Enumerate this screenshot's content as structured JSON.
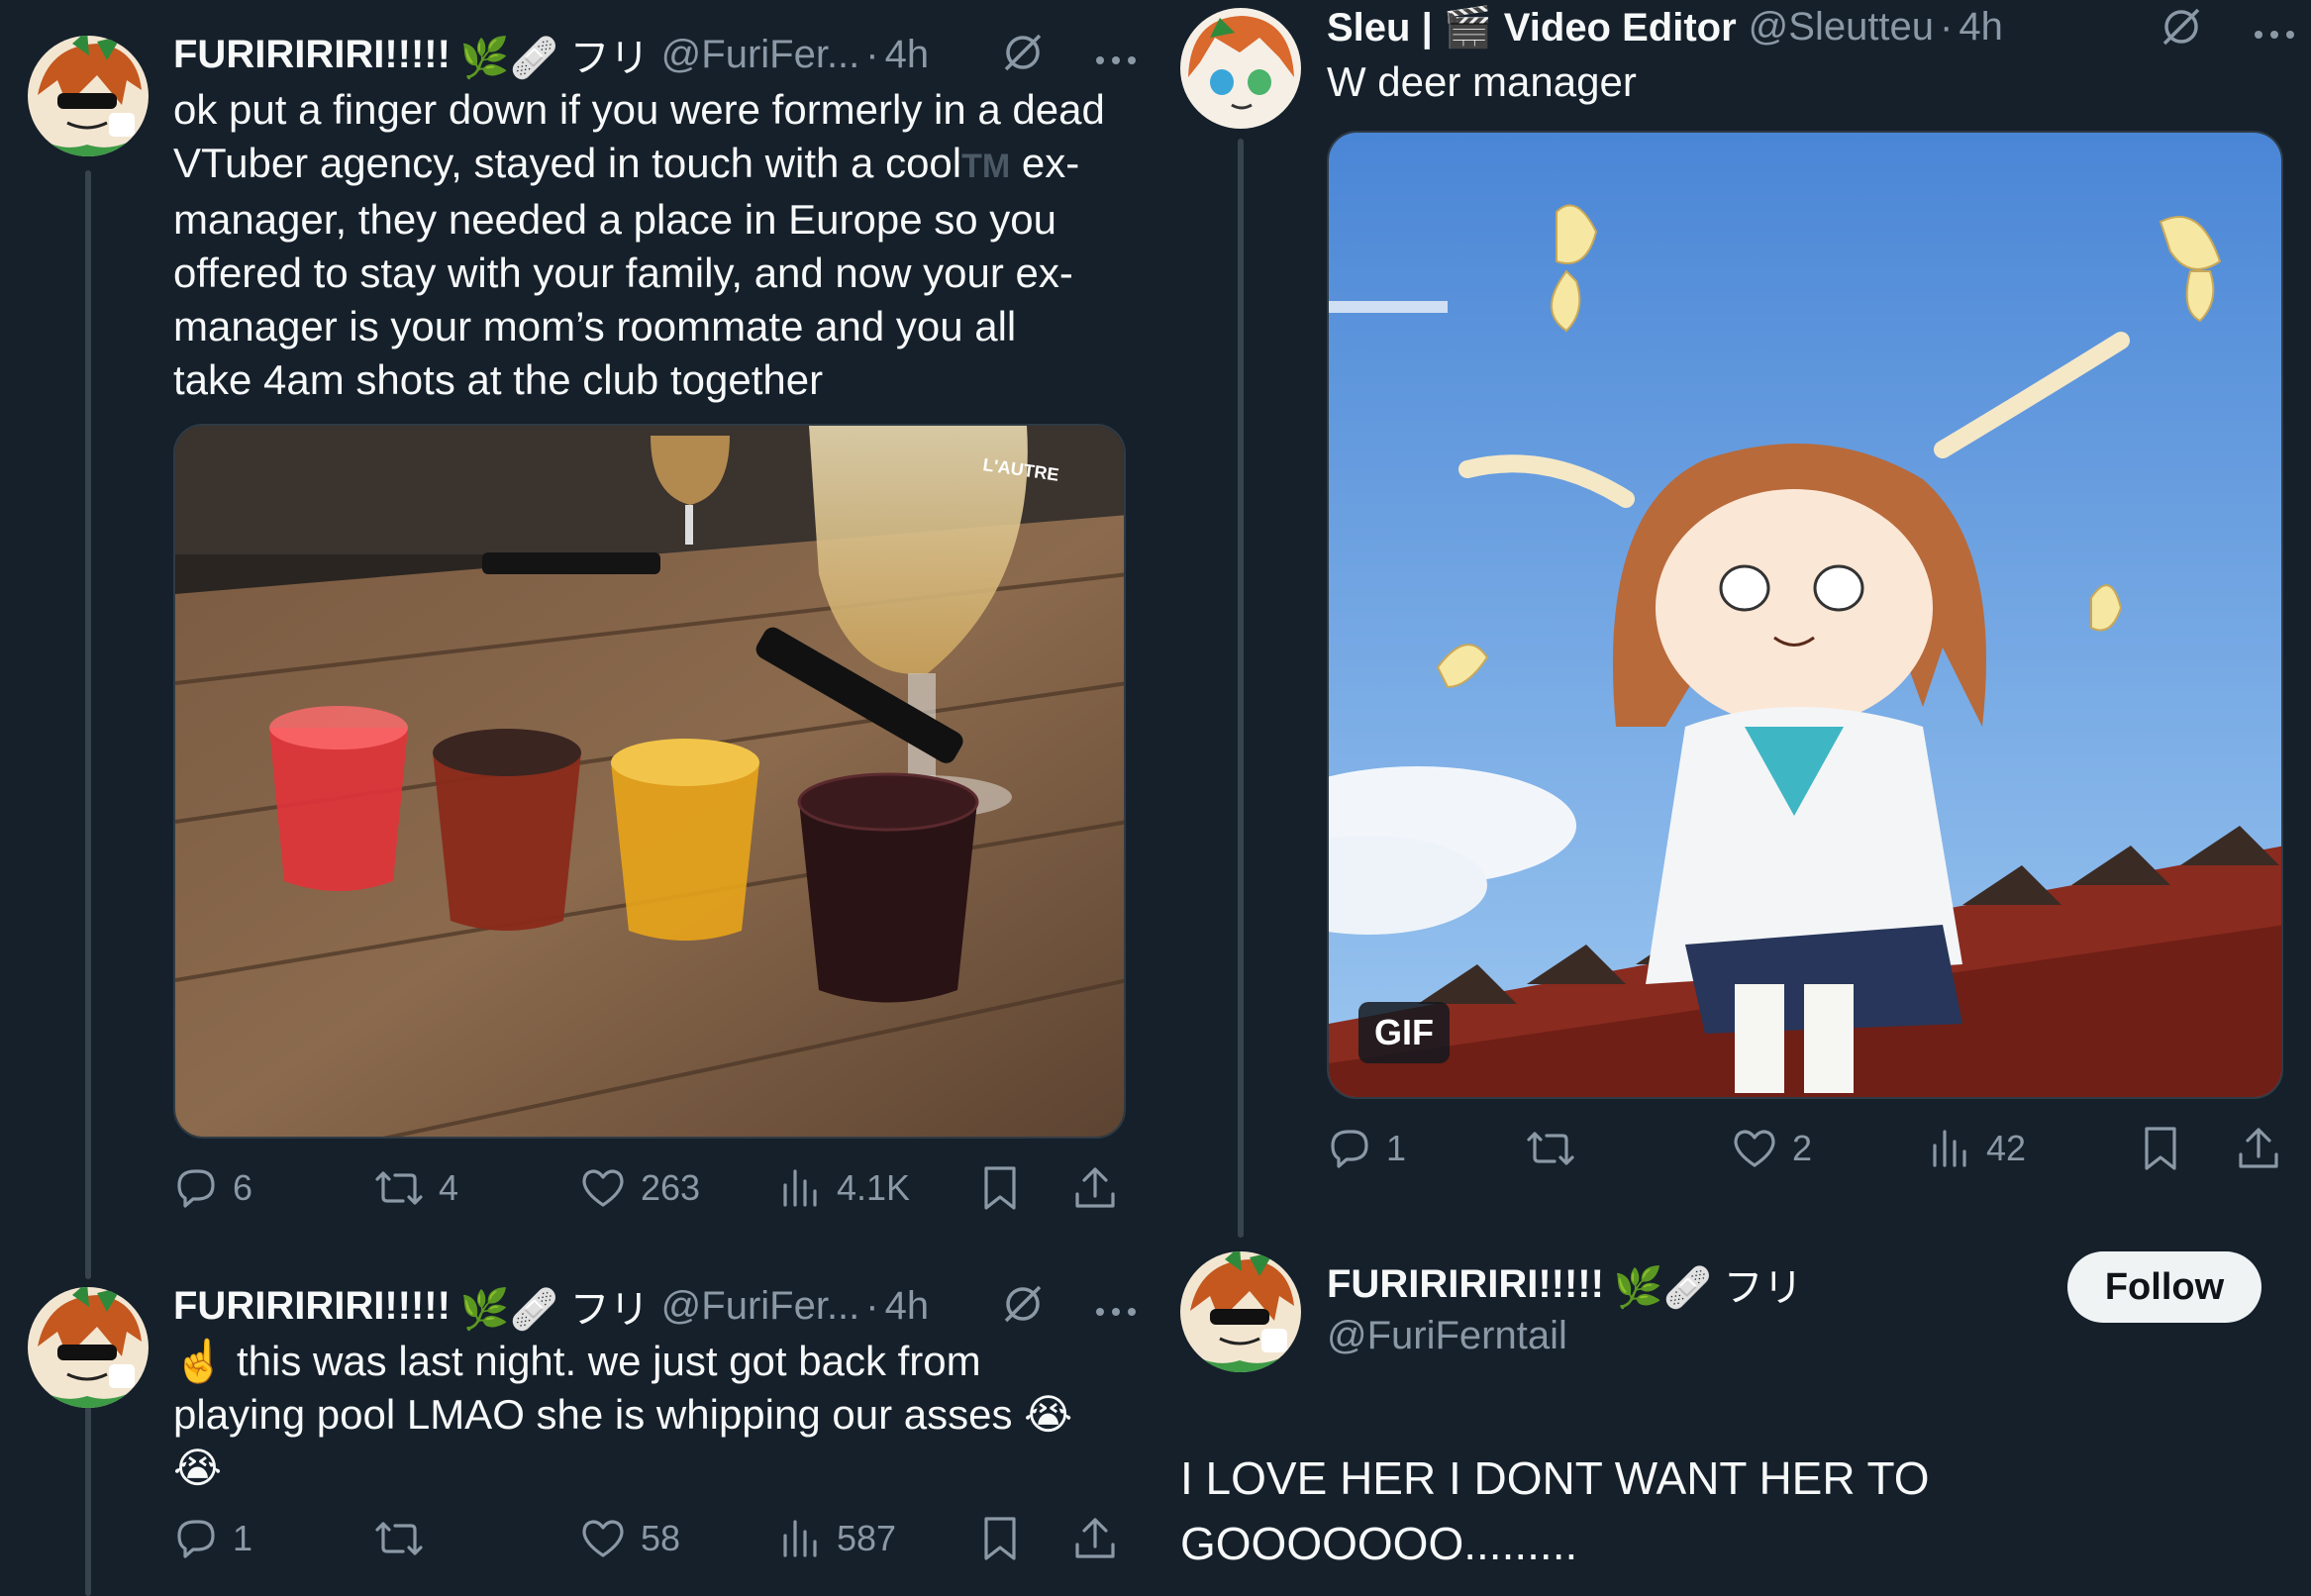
{
  "left": {
    "tweet1": {
      "name": "FURIRIRIRI!!!!!",
      "name_emoji": "🌿🩹 フリ",
      "handle": "@FuriFer...",
      "time": "4h",
      "text_lines": [
        "ok put a finger down if you were formerly in a dead",
        "VTuber agency, stayed in touch with a cool",
        "manager, they needed a place in Europe so you",
        "offered to stay with your family, and now your ex-",
        "manager is your mom’s roommate and you all",
        "take 4am shots at the club together"
      ],
      "tm_mark": "TM",
      "line2_tail": " ex-",
      "image_text": "L'AUTRE",
      "actions": {
        "replies": "6",
        "reposts": "4",
        "likes": "263",
        "views": "4.1K"
      }
    },
    "tweet2": {
      "name": "FURIRIRIRI!!!!!",
      "name_emoji": "🌿🩹 フリ",
      "handle": "@FuriFer...",
      "time": "4h",
      "text_lines": [
        "☝️  this was last night. we just got back from",
        "playing pool LMAO she is whipping our asses 😭",
        "😭"
      ],
      "actions": {
        "replies": "1",
        "reposts": "",
        "likes": "58",
        "views": "587"
      }
    }
  },
  "right": {
    "tweet1": {
      "name": "Sleu | 🎬 Video Editor",
      "handle": "@Sleutteu",
      "time": "4h",
      "text": "W deer manager",
      "gif_badge": "GIF",
      "actions": {
        "replies": "1",
        "reposts": "",
        "likes": "2",
        "views": "42"
      }
    },
    "profile": {
      "name": "FURIRIRIRI!!!!!",
      "name_emoji": "🌿🩹 フリ",
      "handle": "@FuriFerntail",
      "follow_label": "Follow",
      "text_line1": "I LOVE HER I DONT WANT HER TO",
      "text_line2": "GOOOOOOO........."
    }
  },
  "colors": {
    "bg": "#15202b",
    "muted": "#8b98a5",
    "text": "#f7f9f9",
    "line": "#38444d"
  },
  "icons": [
    "grok-icon",
    "more-icon",
    "reply-icon",
    "repost-icon",
    "like-icon",
    "views-icon",
    "bookmark-icon",
    "share-icon"
  ]
}
